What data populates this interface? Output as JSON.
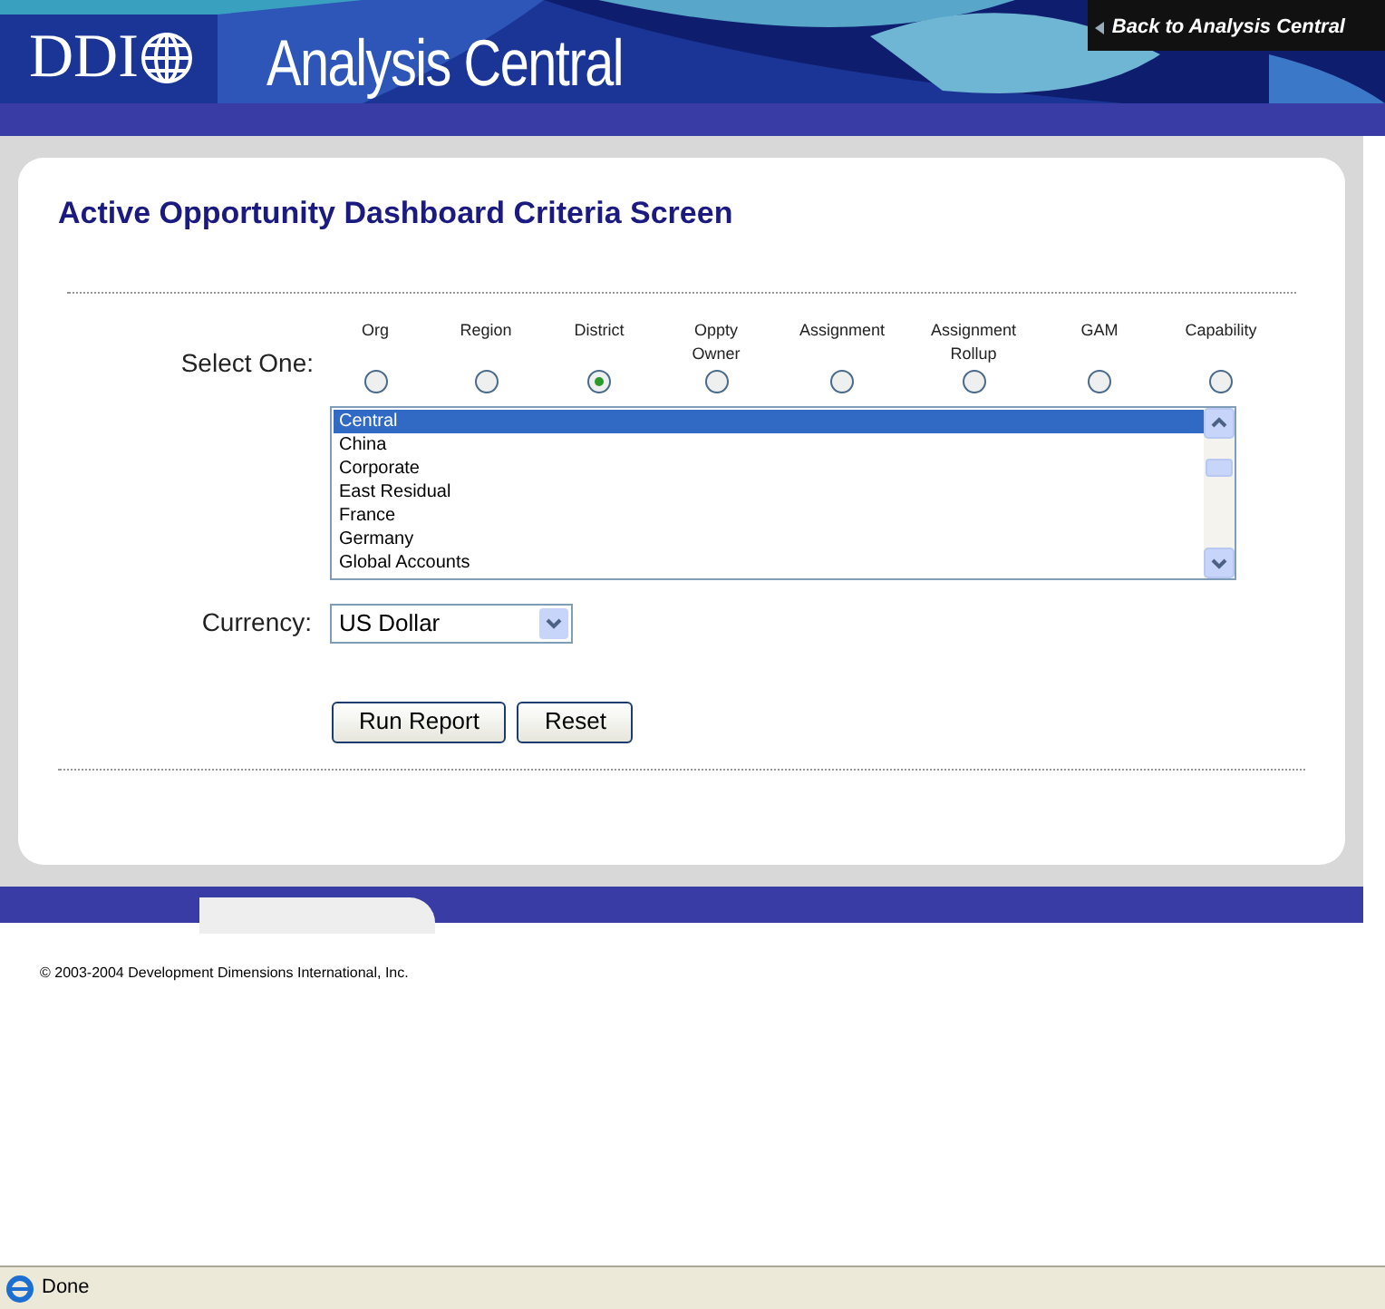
{
  "header": {
    "logo": "DDI",
    "title": "Analysis Central",
    "back_link": "Back to Analysis Central"
  },
  "page_title": "Active Opportunity Dashboard Criteria Screen",
  "select_one": {
    "label": "Select One:",
    "options": [
      {
        "label": "Org",
        "selected": false
      },
      {
        "label": "Region",
        "selected": false
      },
      {
        "label": "District",
        "selected": true
      },
      {
        "label": "Oppty Owner",
        "selected": false
      },
      {
        "label": "Assignment",
        "selected": false
      },
      {
        "label": "Assignment Rollup",
        "selected": false
      },
      {
        "label": "GAM",
        "selected": false
      },
      {
        "label": "Capability",
        "selected": false
      }
    ]
  },
  "list": [
    {
      "label": "Central",
      "selected": true
    },
    {
      "label": "China",
      "selected": false
    },
    {
      "label": "Corporate",
      "selected": false
    },
    {
      "label": "East Residual",
      "selected": false
    },
    {
      "label": "France",
      "selected": false
    },
    {
      "label": "Germany",
      "selected": false
    },
    {
      "label": "Global Accounts",
      "selected": false
    }
  ],
  "currency": {
    "label": "Currency:",
    "value": "US Dollar"
  },
  "buttons": [
    "Run Report",
    "Reset"
  ],
  "footer": "© 2003-2004 Development Dimensions International, Inc.",
  "status_bar": "Done"
}
